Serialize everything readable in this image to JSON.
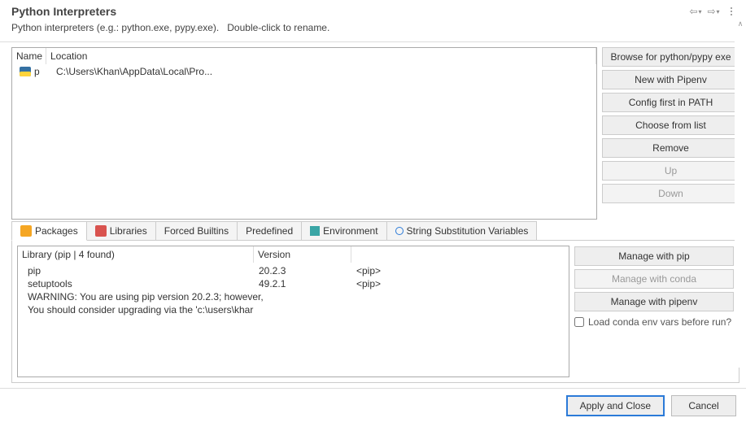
{
  "header": {
    "title": "Python Interpreters",
    "desc_prefix": "Python interpreters (e.g.: python.exe, pypy.exe).",
    "desc_suffix": "Double-click to rename."
  },
  "interpreters": {
    "columns": {
      "name": "Name",
      "location": "Location"
    },
    "rows": [
      {
        "name": "p",
        "location": "C:\\Users\\Khan\\AppData\\Local\\Pro..."
      }
    ]
  },
  "side_buttons": {
    "browse": "Browse for python/pypy exe",
    "pipenv": "New with Pipenv",
    "config": "Config first in PATH",
    "choose": "Choose from list",
    "remove": "Remove",
    "up": "Up",
    "down": "Down"
  },
  "tabs": {
    "packages": "Packages",
    "libraries": "Libraries",
    "forced": "Forced Builtins",
    "predefined": "Predefined",
    "environment": "Environment",
    "string_sub": "String Substitution Variables"
  },
  "packages": {
    "header_library": "Library (pip | 4 found)",
    "header_version": "Version",
    "rows": [
      {
        "lib": "pip",
        "ver": "20.2.3",
        "kind": "<pip>"
      },
      {
        "lib": "setuptools",
        "ver": "49.2.1",
        "kind": "<pip>"
      }
    ],
    "warnings": [
      "WARNING: You are using pip version 20.2.3; however,",
      "You should consider upgrading via the 'c:\\users\\khar"
    ]
  },
  "pkg_buttons": {
    "pip": "Manage with pip",
    "conda": "Manage with conda",
    "pipenv": "Manage with pipenv",
    "checkbox": "Load conda env vars before run?"
  },
  "footer": {
    "apply": "Apply and Close",
    "cancel": "Cancel"
  }
}
